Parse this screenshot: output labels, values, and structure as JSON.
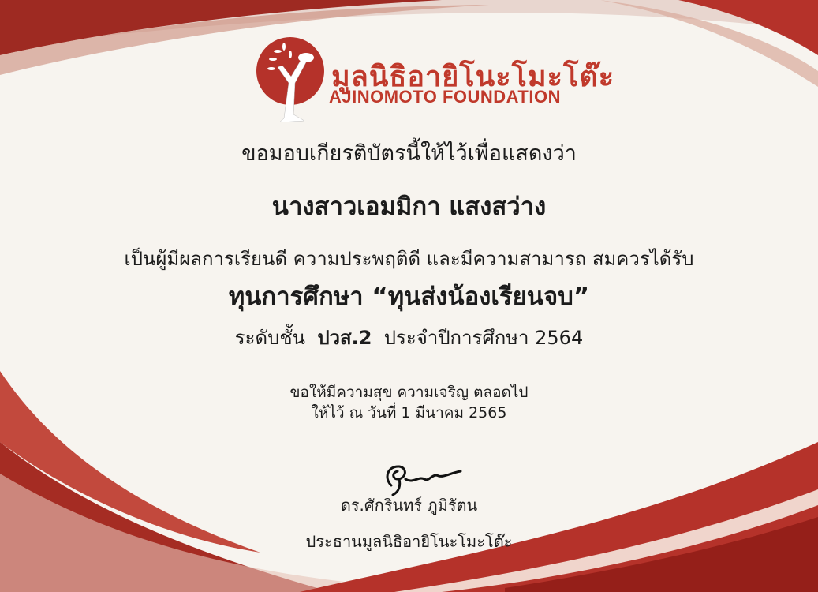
{
  "logo": {
    "thai_name": "มูลนิธิอายิโนะโมะโต๊ะ",
    "english_name": "AJINOMOTO FOUNDATION",
    "color": "#b5322a"
  },
  "certificate": {
    "intro": "ขอมอบเกียรติบัตรนี้ให้ไว้เพื่อแสดงว่า",
    "recipient": "นางสาวเอมมิกา แสงสว่าง",
    "reason": "เป็นผู้มีผลการเรียนดี ความประพฤติดี และมีความสามารถ สมควรได้รับ",
    "award": "ทุนการศึกษา “ทุนส่งน้องเรียนจบ”",
    "level_label": "ระดับชั้น",
    "level": "ปวส.2",
    "year_label": "ประจำปีการศึกษา 2564",
    "wish": "ขอให้มีความสุข ความเจริญ ตลอดไป",
    "date": "ให้ไว้ ณ วันที่ 1 มีนาคม 2565"
  },
  "signatory": {
    "name": "ดร.ศักรินทร์ ภูมิรัตน",
    "title": "ประธานมูลนิธิอายิโนะโมะโต๊ะ"
  },
  "colors": {
    "accent": "#b5322a",
    "paper": "#f7f4ef"
  }
}
